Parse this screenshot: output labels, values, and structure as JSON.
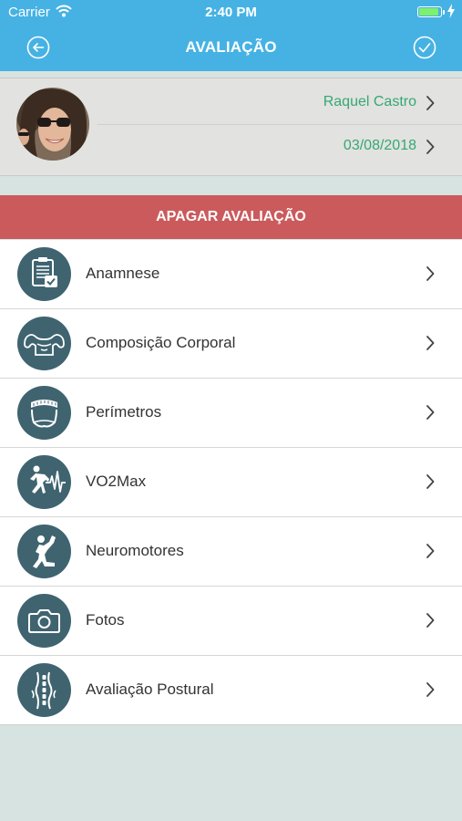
{
  "status_bar": {
    "carrier": "Carrier",
    "time": "2:40 PM",
    "battery_level": 0.92
  },
  "nav": {
    "title": "AVALIAÇÃO",
    "back_icon": "back-circle-icon",
    "confirm_icon": "check-circle-icon"
  },
  "profile": {
    "name": "Raquel Castro",
    "date": "03/08/2018"
  },
  "delete_button": {
    "label": "APAGAR AVALIAÇÃO"
  },
  "menu": {
    "items": [
      {
        "label": "Anamnese",
        "icon": "clipboard-icon"
      },
      {
        "label": "Composição Corporal",
        "icon": "body-composition-icon"
      },
      {
        "label": "Perímetros",
        "icon": "tape-measure-icon"
      },
      {
        "label": "VO2Max",
        "icon": "runner-heartbeat-icon"
      },
      {
        "label": "Neuromotores",
        "icon": "stretching-person-icon"
      },
      {
        "label": "Fotos",
        "icon": "camera-icon"
      },
      {
        "label": "Avaliação Postural",
        "icon": "posture-icon"
      }
    ]
  },
  "colors": {
    "header": "#46b2e4",
    "accent_green": "#35a873",
    "delete_red": "#cb5a5c",
    "icon_circle": "#3f6470",
    "background": "#d6e3e0"
  }
}
